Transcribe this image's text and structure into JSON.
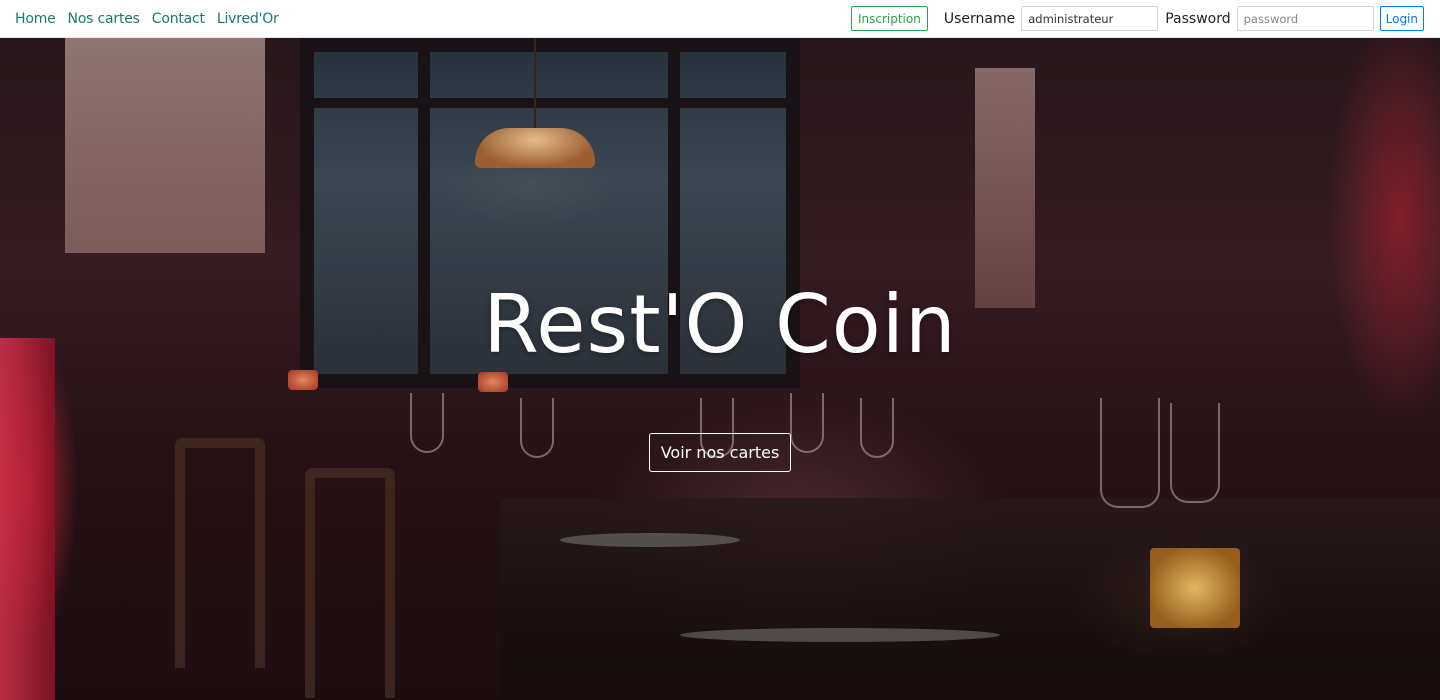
{
  "nav": {
    "links": [
      {
        "label": "Home"
      },
      {
        "label": "Nos cartes"
      },
      {
        "label": "Contact"
      },
      {
        "label": "Livred'Or"
      }
    ],
    "inscription_label": "Inscription",
    "username_label": "Username",
    "username_value": "administrateur",
    "password_label": "Password",
    "password_placeholder": "password",
    "login_label": "Login"
  },
  "hero": {
    "title": "Rest'O Coin",
    "cta_label": "Voir nos cartes"
  },
  "colors": {
    "nav_link": "#1b7a6e",
    "inscription": "#28a745",
    "login": "#007bff",
    "hero_text": "#ffffff"
  }
}
